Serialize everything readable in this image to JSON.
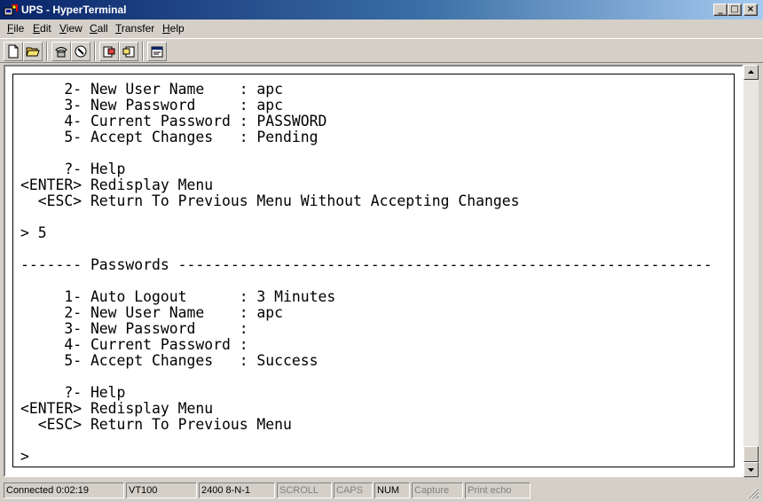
{
  "window": {
    "title": "UPS - HyperTerminal",
    "controls": {
      "minimize": "_",
      "maximize": "□",
      "close": "×"
    }
  },
  "menu": {
    "items": [
      {
        "u": "F",
        "rest": "ile"
      },
      {
        "u": "E",
        "rest": "dit"
      },
      {
        "u": "V",
        "rest": "iew"
      },
      {
        "u": "C",
        "rest": "all"
      },
      {
        "u": "T",
        "rest": "ransfer"
      },
      {
        "u": "H",
        "rest": "elp"
      }
    ]
  },
  "toolbar": {
    "icons": [
      "new-connection-icon",
      "open-icon",
      "connect-icon",
      "disconnect-icon",
      "send-icon",
      "receive-icon",
      "properties-icon"
    ]
  },
  "terminal": {
    "lines": [
      "     2- New User Name    : apc",
      "     3- New Password     : apc",
      "     4- Current Password : PASSWORD",
      "     5- Accept Changes   : Pending",
      "",
      "     ?- Help",
      "<ENTER> Redisplay Menu",
      "  <ESC> Return To Previous Menu Without Accepting Changes",
      "",
      "> 5",
      "",
      "------- Passwords -------------------------------------------------------------",
      "",
      "     1- Auto Logout      : 3 Minutes",
      "     2- New User Name    : apc",
      "     3- New Password     :",
      "     4- Current Password :",
      "     5- Accept Changes   : Success",
      "",
      "     ?- Help",
      "<ENTER> Redisplay Menu",
      "  <ESC> Return To Previous Menu",
      "",
      ">"
    ]
  },
  "status": {
    "connected": "Connected 0:02:19",
    "emulation": "VT100",
    "settings": "2400 8-N-1",
    "scroll": "SCROLL",
    "caps": "CAPS",
    "num": "NUM",
    "capture": "Capture",
    "print_echo": "Print echo"
  }
}
